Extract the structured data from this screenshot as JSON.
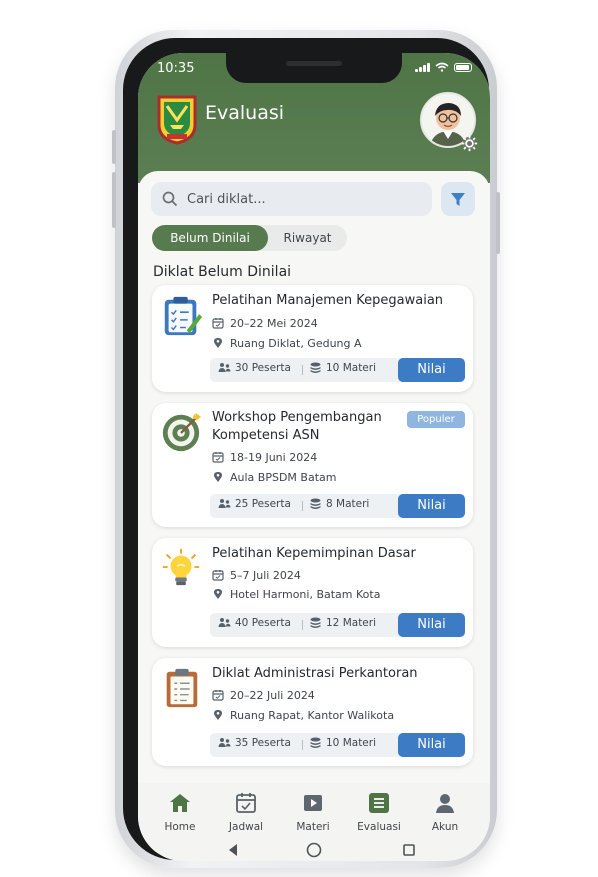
{
  "status_bar": {
    "time": "10:35"
  },
  "header": {
    "title": "Evaluasi"
  },
  "search": {
    "placeholder": "Cari diklat..."
  },
  "tabs": [
    {
      "label": "Belum Dinilai",
      "active": true
    },
    {
      "label": "Riwayat",
      "active": false
    }
  ],
  "section_title": "Diklat Belum Dinilai",
  "courses": [
    {
      "title_lines": [
        "Pelatihan Manajemen Kepegawaian"
      ],
      "date": "20–22 Mei 2024",
      "location": "Ruang Diklat, Gedung A",
      "participants": "30 Peserta",
      "materials": "10 Materi",
      "button": "Nilai",
      "icon": "clipboard-check-icon"
    },
    {
      "title_lines": [
        "Workshop Pengembangan",
        "Kompetensi ASN"
      ],
      "date": "18-19 Juni 2024",
      "location": "Aula BPSDM Batam",
      "participants": "25 Peserta",
      "materials": "8 Materi",
      "button": "Nilai",
      "badge": "Populer",
      "icon": "target-icon"
    },
    {
      "title_lines": [
        "Pelatihan Kepemimpinan Dasar"
      ],
      "date": "5–7 Juli 2024",
      "location": "Hotel Harmoni, Batam Kota",
      "participants": "40 Peserta",
      "materials": "12 Materi",
      "button": "Nilai",
      "icon": "lightbulb-icon"
    },
    {
      "title_lines": [
        "Diklat Administrasi Perkantoran"
      ],
      "date": "20–22 Juli 2024",
      "location": "Ruang Rapat, Kantor Walikota",
      "participants": "35 Peserta",
      "materials": "10 Materi",
      "button": "Nilai",
      "icon": "clipboard-list-icon"
    }
  ],
  "bottom_nav": [
    {
      "label": "Home",
      "icon": "home-icon"
    },
    {
      "label": "Jadwal",
      "icon": "calendar-icon"
    },
    {
      "label": "Materi",
      "icon": "play-icon"
    },
    {
      "label": "Evaluasi",
      "icon": "evaluation-icon",
      "active": true
    },
    {
      "label": "Akun",
      "icon": "user-icon"
    }
  ],
  "colors": {
    "primary": "#577B4F",
    "header": "#557A4C",
    "button": "#3D7BC4",
    "badge": "#8FB5E0"
  }
}
